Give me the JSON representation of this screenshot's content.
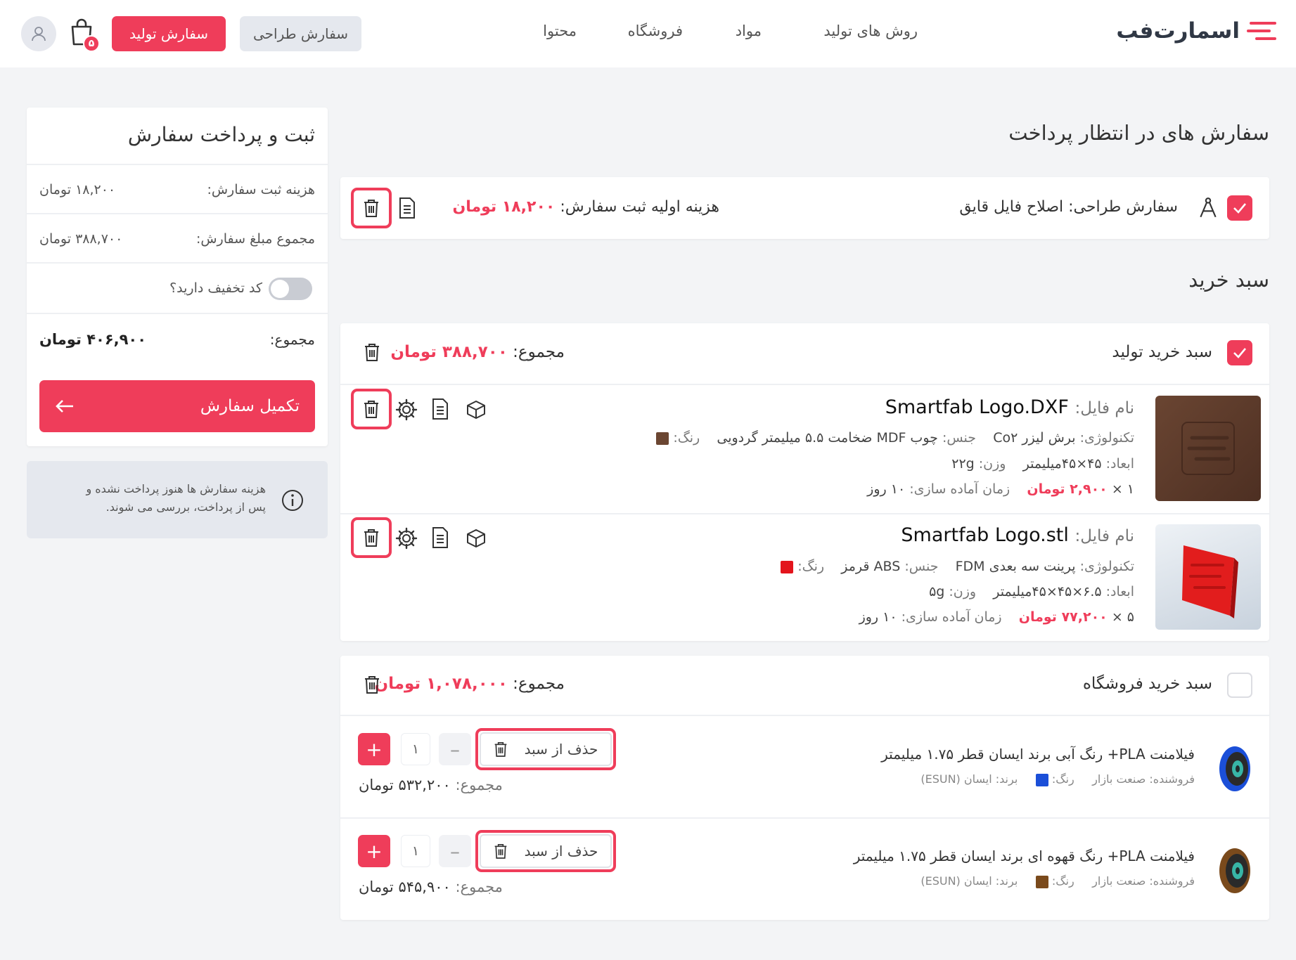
{
  "header": {
    "logo_text": "اسمارت‌فب",
    "nav": [
      "روش های تولید",
      "مواد",
      "فروشگاه",
      "محتوا"
    ],
    "btn_design": "سفارش طراحی",
    "btn_production": "سفارش تولید",
    "cart_count": "۵"
  },
  "pending": {
    "title": "سفارش های در انتظار پرداخت",
    "label": "سفارش طراحی:",
    "name": "اصلاح فایل قایق",
    "fee_label": "هزینه اولیه ثبت سفارش:",
    "fee_value": "۱۸,۲۰۰ تومان"
  },
  "cart_title": "سبد خرید",
  "production_cart": {
    "title": "سبد خرید تولید",
    "total_label": "مجموع:",
    "total_value": "۳۸۸,۷۰۰ تومان",
    "items": [
      {
        "file_label": "نام فایل:",
        "file_name": "Smartfab Logo.DXF",
        "tech_label": "تکنولوژی:",
        "tech": "برش لیزر Co۲",
        "material_label": "جنس:",
        "material": "چوب MDF ضخامت ۵.۵ میلیمتر گردویی",
        "color_label": "رنگ:",
        "color": "#6b4632",
        "dims_label": "ابعاد:",
        "dims": "۴۵×۴۵میلیمتر",
        "weight_label": "وزن:",
        "weight": "۲۲g",
        "qty": "۱ ×",
        "price": "۲,۹۰۰ تومان",
        "lead_label": "زمان آماده سازی:",
        "lead": "۱۰ روز"
      },
      {
        "file_label": "نام فایل:",
        "file_name": "Smartfab Logo.stl",
        "tech_label": "تکنولوژی:",
        "tech": "پرینت سه بعدی FDM",
        "material_label": "جنس:",
        "material": "ABS قرمز",
        "color_label": "رنگ:",
        "color": "#e3141c",
        "dims_label": "ابعاد:",
        "dims": "۶.۵×۴۵×۴۵میلیمتر",
        "weight_label": "وزن:",
        "weight": "۵g",
        "qty": "۵ ×",
        "price": "۷۷,۲۰۰ تومان",
        "lead_label": "زمان آماده سازی:",
        "lead": "۱۰ روز"
      }
    ]
  },
  "shop_cart": {
    "title": "سبد خرید فروشگاه",
    "total_label": "مجموع:",
    "total_value": "۱,۰۷۸,۰۰۰ تومان",
    "remove_label": "حذف از سبد",
    "items": [
      {
        "name": "فیلامنت PLA+ رنگ آبی برند ایسان قطر ۱.۷۵ میلیمتر",
        "seller": "فروشنده: صنعت بازار",
        "color_label": "رنگ:",
        "color": "#1b4fd8",
        "brand": "برند: ایسان (ESUN)",
        "qty": "۱",
        "subtotal_label": "مجموع:",
        "subtotal": "۵۳۲,۲۰۰ تومان"
      },
      {
        "name": "فیلامنت PLA+ رنگ قهوه ای برند ایسان قطر ۱.۷۵ میلیمتر",
        "seller": "فروشنده: صنعت بازار",
        "color_label": "رنگ:",
        "color": "#7a4a1c",
        "brand": "برند: ایسان (ESUN)",
        "qty": "۱",
        "subtotal_label": "مجموع:",
        "subtotal": "۵۴۵,۹۰۰ تومان"
      }
    ]
  },
  "summary": {
    "title": "ثبت و پرداخت سفارش",
    "reg_fee_label": "هزینه ثبت سفارش:",
    "reg_fee": "۱۸,۲۰۰ تومان",
    "order_total_label": "مجموع مبلغ سفارش:",
    "order_total": "۳۸۸,۷۰۰ تومان",
    "discount_label": "کد تخفیف دارید؟",
    "grand_label": "مجموع:",
    "grand_value": "۴۰۶,۹۰۰ تومان",
    "checkout_label": "تکمیل سفارش",
    "info_line1": "هزینه سفارش ها هنوز پرداخت نشده و",
    "info_line2": "پس از پرداخت، بررسی می شوند."
  }
}
